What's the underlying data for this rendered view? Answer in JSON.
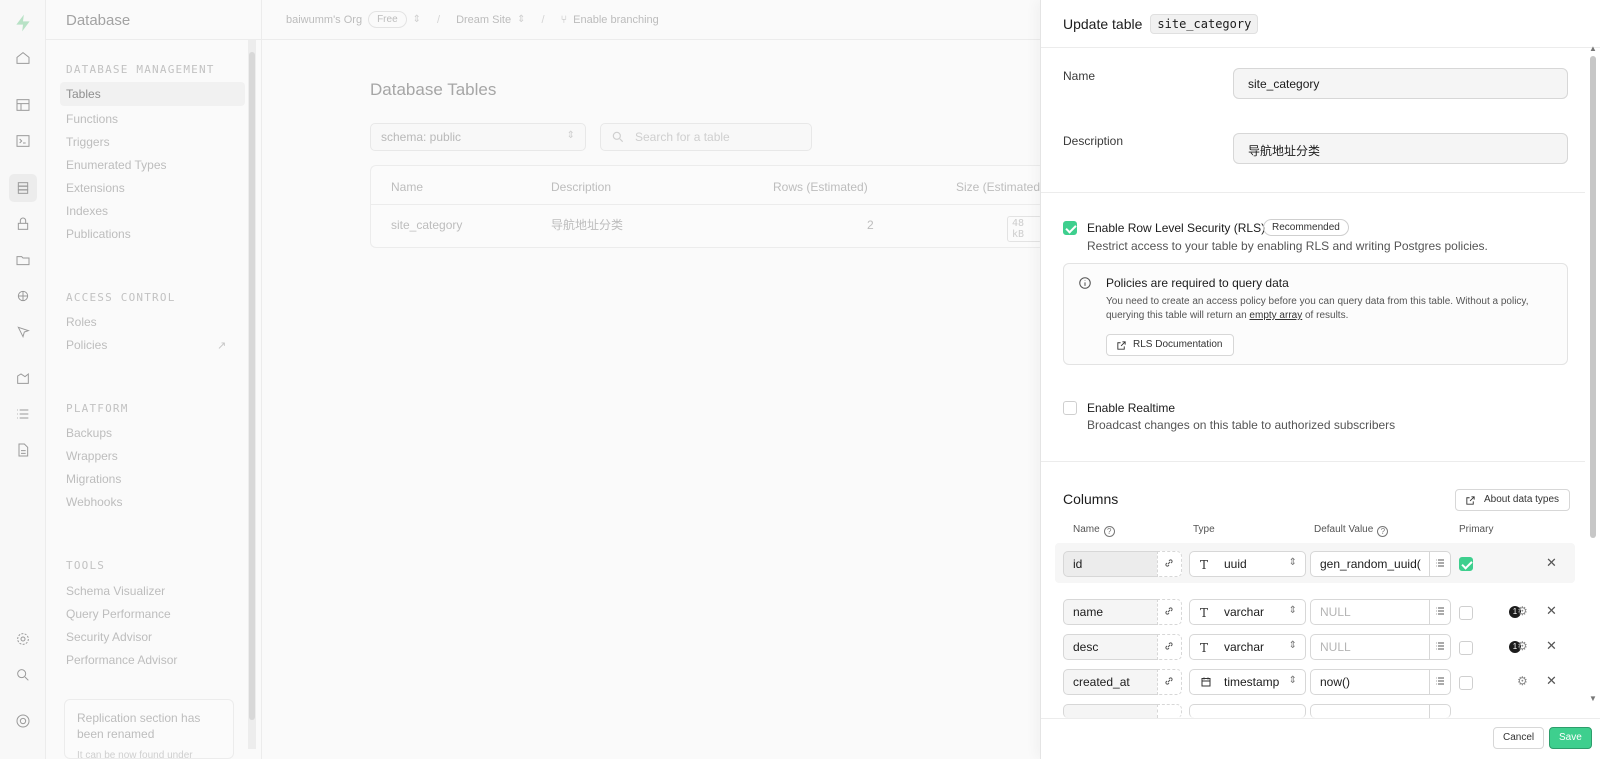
{
  "topbar": {
    "org": "baiwumm's Org",
    "plan": "Free",
    "project": "Dream Site",
    "branching": "Enable branching"
  },
  "sidebar": {
    "title": "Database",
    "sections": [
      {
        "title": "DATABASE MANAGEMENT",
        "items": [
          "Tables",
          "Functions",
          "Triggers",
          "Enumerated Types",
          "Extensions",
          "Indexes",
          "Publications"
        ]
      },
      {
        "title": "ACCESS CONTROL",
        "items": [
          "Roles",
          "Policies"
        ]
      },
      {
        "title": "PLATFORM",
        "items": [
          "Backups",
          "Wrappers",
          "Migrations",
          "Webhooks"
        ]
      },
      {
        "title": "TOOLS",
        "items": [
          "Schema Visualizer",
          "Query Performance",
          "Security Advisor",
          "Performance Advisor"
        ]
      }
    ],
    "active_item": "Tables",
    "notice": {
      "title": "Replication section has been renamed",
      "sub": "It can be now found under"
    }
  },
  "main": {
    "title": "Database Tables",
    "schema_label": "schema: public",
    "search_placeholder": "Search for a table",
    "table": {
      "headers": [
        "Name",
        "Description",
        "Rows (Estimated)",
        "Size (Estimated)"
      ],
      "rows": [
        {
          "name": "site_category",
          "description": "导航地址分类",
          "rows": "2",
          "size": "48 kB"
        }
      ]
    }
  },
  "panel": {
    "title": "Update table",
    "table_name": "site_category",
    "name_label": "Name",
    "name_value": "site_category",
    "desc_label": "Description",
    "desc_value": "导航地址分类",
    "rls": {
      "checked": true,
      "title": "Enable Row Level Security (RLS)",
      "badge": "Recommended",
      "sub": "Restrict access to your table by enabling RLS and writing Postgres policies.",
      "alert_title": "Policies are required to query data",
      "alert_text_1": "You need to create an access policy before you can query data from this table. Without a policy, querying this table will return an ",
      "alert_link": "empty array",
      "alert_text_2": " of results.",
      "doc_button": "RLS Documentation"
    },
    "realtime": {
      "checked": false,
      "title": "Enable Realtime",
      "sub": "Broadcast changes on this table to authorized subscribers"
    },
    "columns_title": "Columns",
    "about_types": "About data types",
    "col_headers": {
      "name": "Name",
      "type": "Type",
      "default": "Default Value",
      "primary": "Primary"
    },
    "columns": [
      {
        "name": "id",
        "type": "uuid",
        "default": "gen_random_uuid(",
        "primary": true,
        "badge": ""
      },
      {
        "name": "name",
        "type": "varchar",
        "default": "NULL",
        "primary": false,
        "badge": "1"
      },
      {
        "name": "desc",
        "type": "varchar",
        "default": "NULL",
        "primary": false,
        "badge": "1"
      },
      {
        "name": "created_at",
        "type": "timestamp",
        "default": "now()",
        "primary": false,
        "badge": ""
      }
    ],
    "cancel": "Cancel",
    "save": "Save"
  },
  "colors": {
    "accent": "#3ecf8e"
  }
}
